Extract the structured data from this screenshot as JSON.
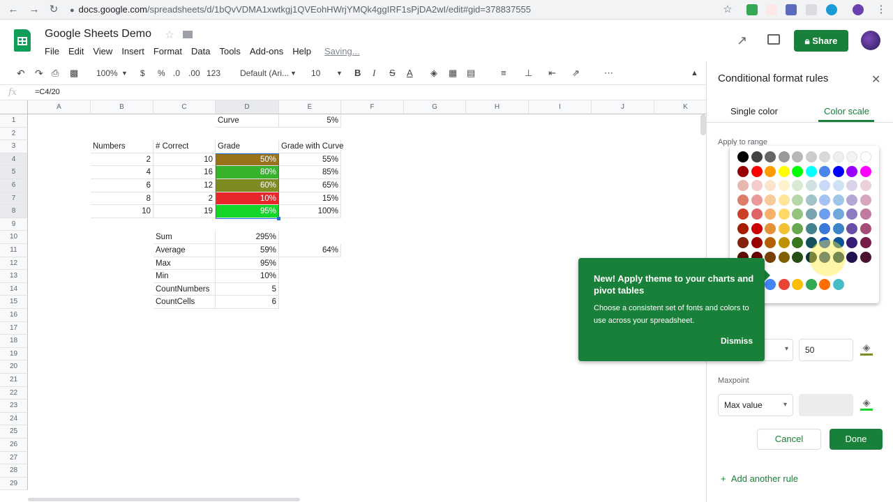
{
  "browser": {
    "url_main": "docs.google.com",
    "url_tail": "/spreadsheets/d/1bQvVDMA1xwtkgj1QVEohHWrjYMQk4ggIRF1sPjDA2wI/edit#gid=378837555"
  },
  "app": {
    "title": "Google Sheets Demo",
    "saving": "Saving...",
    "share_label": "Share",
    "menu": [
      "File",
      "Edit",
      "View",
      "Insert",
      "Format",
      "Data",
      "Tools",
      "Add-ons",
      "Help"
    ]
  },
  "toolbar": {
    "zoom": "100%",
    "currency": "$",
    "percent": "%",
    "dec_less": ".0",
    "dec_more": ".00",
    "format_more": "123",
    "font": "Default (Ari...",
    "font_size": "10",
    "bold": "B",
    "italic": "I",
    "strike": "S",
    "text_color": "A"
  },
  "formula_bar": {
    "fx": "fx",
    "formula": "=C4/20"
  },
  "grid": {
    "columns": [
      "A",
      "B",
      "C",
      "D",
      "E",
      "F",
      "G",
      "H",
      "I",
      "J",
      "K"
    ],
    "rows": [
      "1",
      "2",
      "3",
      "4",
      "5",
      "6",
      "7",
      "8",
      "9",
      "10",
      "11",
      "12",
      "13",
      "14",
      "15",
      "16",
      "17",
      "18",
      "19",
      "20",
      "21",
      "22",
      "23",
      "24",
      "25",
      "26",
      "27",
      "28",
      "29"
    ],
    "cells": {
      "D1": "Curve",
      "E1": "5%",
      "B3": "Numbers",
      "C3": "# Correct",
      "D3": "Grade",
      "E3": "Grade with Curve",
      "B4": "2",
      "C4": "10",
      "D4": "50%",
      "E4": "55%",
      "B5": "4",
      "C5": "16",
      "D5": "80%",
      "E5": "85%",
      "B6": "6",
      "C6": "12",
      "D6": "60%",
      "E6": "65%",
      "B7": "8",
      "C7": "2",
      "D7": "10%",
      "E7": "15%",
      "B8": "10",
      "C8": "19",
      "D8": "95%",
      "E8": "100%",
      "C10": "Sum",
      "D10": "295%",
      "C11": "Average",
      "D11": "59%",
      "E11": "64%",
      "C12": "Max",
      "D12": "95%",
      "C13": "Min",
      "D13": "10%",
      "C14": "CountNumbers",
      "D14": "5",
      "C15": "CountCells",
      "D15": "6"
    },
    "grade_fill_colors": {
      "D4": "#98731a",
      "D5": "#38b32e",
      "D6": "#7d8b20",
      "D7": "#e8272c",
      "D8": "#16d52a"
    }
  },
  "panel": {
    "title": "Conditional format rules",
    "tab_single": "Single color",
    "tab_scale": "Color scale",
    "apply_range_label": "Apply to range",
    "midpoint_value": "50",
    "maxpoint_label": "Maxpoint",
    "max_select": "Max value",
    "cancel": "Cancel",
    "done": "Done",
    "add_rule": "Add another rule"
  },
  "palette": {
    "rows": [
      [
        "#000000",
        "#434343",
        "#666666",
        "#999999",
        "#b7b7b7",
        "#cccccc",
        "#d9d9d9",
        "#efefef",
        "#f3f3f3",
        "#ffffff"
      ],
      [
        "#980000",
        "#ff0000",
        "#ff9900",
        "#ffff00",
        "#00ff00",
        "#00ffff",
        "#4a86e8",
        "#0000ff",
        "#9900ff",
        "#ff00ff"
      ],
      [
        "#e6b8af",
        "#f4cccc",
        "#fce5cd",
        "#fff2cc",
        "#d9ead3",
        "#d0e0e3",
        "#c9daf8",
        "#cfe2f3",
        "#d9d2e9",
        "#ead1dc"
      ],
      [
        "#dd7e6b",
        "#ea9999",
        "#f9cb9c",
        "#ffe599",
        "#b6d7a8",
        "#a2c4c9",
        "#a4c2f4",
        "#9fc5e8",
        "#b4a7d6",
        "#d5a6bd"
      ],
      [
        "#cc4125",
        "#e06666",
        "#f6b26b",
        "#ffd966",
        "#93c47d",
        "#76a5af",
        "#6d9eeb",
        "#6fa8dc",
        "#8e7cc3",
        "#c27ba0"
      ],
      [
        "#a61c00",
        "#cc0000",
        "#e69138",
        "#f1c232",
        "#6aa84f",
        "#45818e",
        "#3c78d8",
        "#3d85c6",
        "#674ea7",
        "#a64d79"
      ],
      [
        "#85200c",
        "#990000",
        "#b45f06",
        "#bf9000",
        "#38761d",
        "#134f5c",
        "#1155cc",
        "#0b5394",
        "#351c75",
        "#741b47"
      ],
      [
        "#5b0f00",
        "#660000",
        "#783f04",
        "#7f6000",
        "#274e13",
        "#0c343d",
        "#1c4587",
        "#073763",
        "#20124d",
        "#4c1130"
      ]
    ],
    "theme_colors": [
      "#4285f4",
      "#ea4335",
      "#fbbc04",
      "#34a853",
      "#ff6d01",
      "#46bdc6"
    ]
  },
  "tooltip": {
    "title": "New! Apply theme to your charts and pivot tables",
    "body": "Choose a consistent set of fonts and colors to use across your spreadsheet.",
    "dismiss": "Dismiss"
  }
}
